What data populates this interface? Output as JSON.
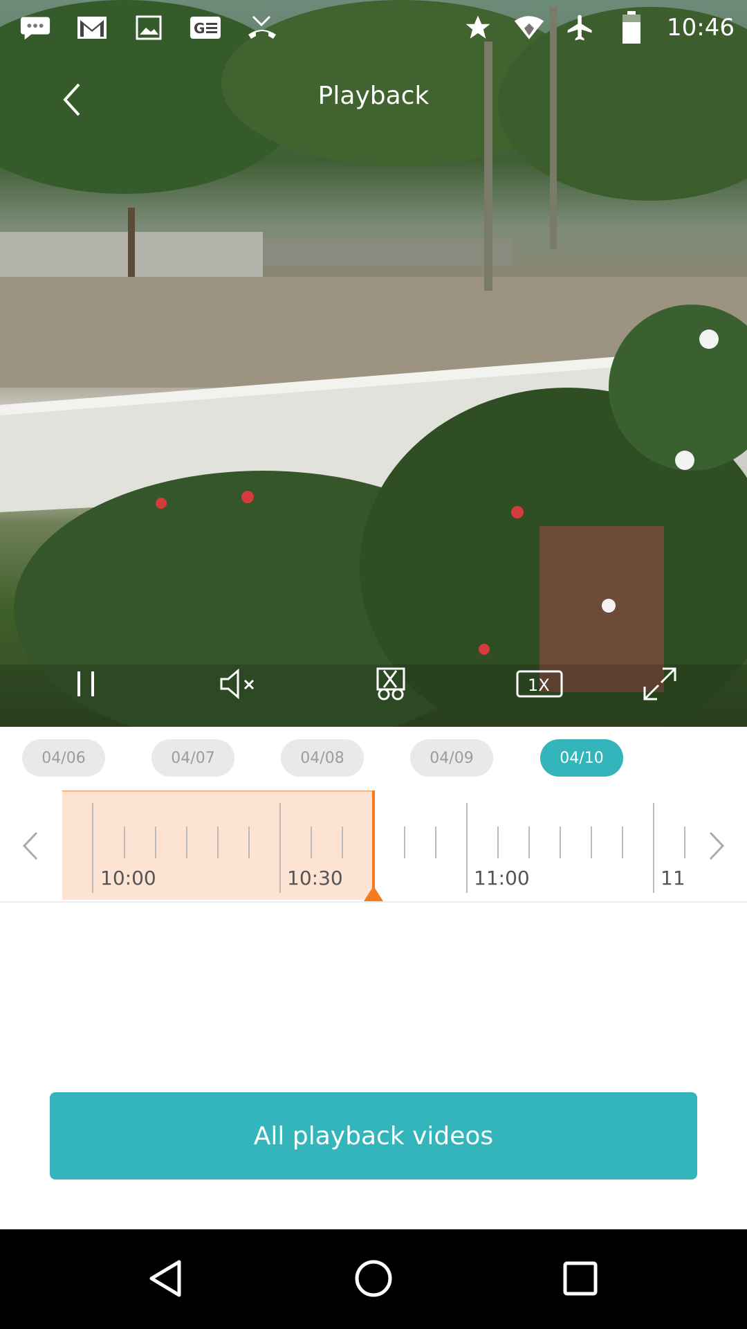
{
  "status_bar": {
    "time": "10:46",
    "left_icons": [
      "chat-icon",
      "gmail-icon",
      "image-icon",
      "news-icon",
      "missed-call-icon"
    ],
    "right_icons": [
      "star-icon",
      "wifi-icon",
      "airplane-icon",
      "battery-icon"
    ]
  },
  "header": {
    "title": "Playback"
  },
  "controls": [
    "pause-icon",
    "mute-icon",
    "scissors-icon",
    "speed-1x-icon",
    "fullscreen-icon"
  ],
  "dates": [
    {
      "label": "04/06",
      "active": false
    },
    {
      "label": "04/07",
      "active": false
    },
    {
      "label": "04/08",
      "active": false
    },
    {
      "label": "04/09",
      "active": false
    },
    {
      "label": "04/10",
      "active": true
    }
  ],
  "timeline": {
    "labels": [
      "10:00",
      "10:30",
      "11:00",
      "11"
    ],
    "recorded_color": "#fde3d1",
    "cursor_color": "#f47b20"
  },
  "actions": {
    "all_videos": "All playback videos"
  },
  "colors": {
    "accent": "#34b5bb"
  }
}
